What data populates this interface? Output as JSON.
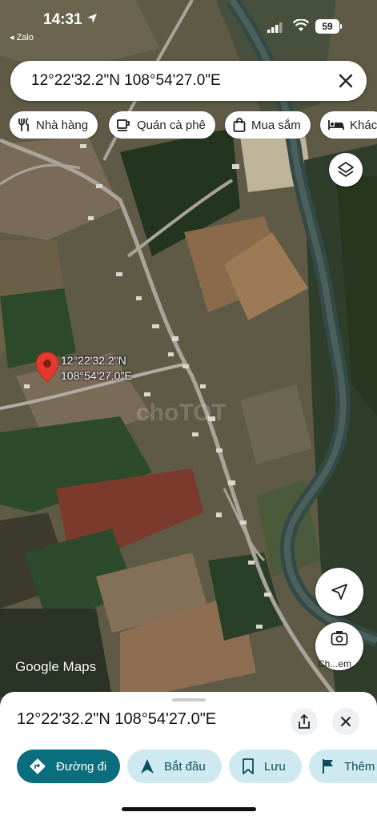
{
  "status_bar": {
    "time": "14:31",
    "back_app": "◂ Zalo",
    "battery": "59"
  },
  "search": {
    "query": "12°22'32.2\"N 108°54'27.0\"E"
  },
  "chips": [
    {
      "label": "Nhà hàng",
      "icon": "restaurant-icon"
    },
    {
      "label": "Quán cà phê",
      "icon": "coffee-icon"
    },
    {
      "label": "Mua sắm",
      "icon": "shopping-bag-icon"
    },
    {
      "label": "Khác",
      "icon": "hotel-icon"
    }
  ],
  "map": {
    "pin_label_line1": "12°22'32.2\"N",
    "pin_label_line2": "108°54'27.0\"E",
    "attribution": "Google Maps",
    "lens_label": "Ch...em",
    "pin_color": "#e23b2e"
  },
  "sheet": {
    "title": "12°22'32.2\"N 108°54'27.0\"E",
    "actions": [
      {
        "label": "Đường đi",
        "icon": "directions-icon"
      },
      {
        "label": "Bắt đầu",
        "icon": "navigation-icon"
      },
      {
        "label": "Lưu",
        "icon": "bookmark-icon"
      },
      {
        "label": "Thêm",
        "icon": "flag-icon"
      }
    ]
  },
  "colors": {
    "primary_action": "#0b6e7e",
    "secondary_action": "#cfe9f1"
  }
}
